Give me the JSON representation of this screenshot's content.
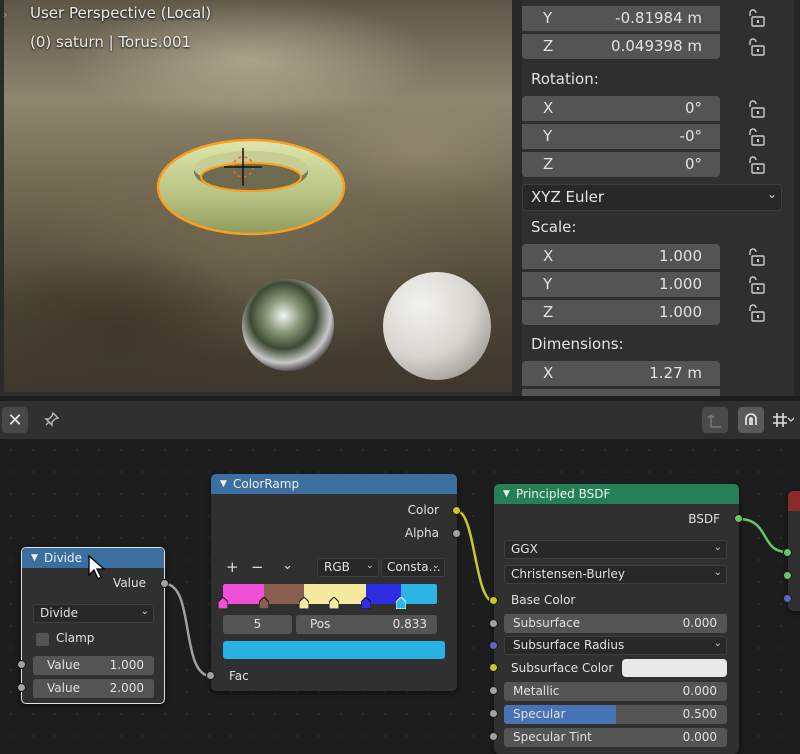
{
  "viewport": {
    "title": "User Perspective (Local)",
    "subtitle": "(0) saturn | Torus.001"
  },
  "properties": {
    "location_y": {
      "axis": "Y",
      "value": "-0.81984 m"
    },
    "location_z": {
      "axis": "Z",
      "value": "0.049398 m"
    },
    "rotation_label": "Rotation:",
    "rotation": [
      {
        "axis": "X",
        "value": "0°"
      },
      {
        "axis": "Y",
        "value": "-0°"
      },
      {
        "axis": "Z",
        "value": "0°"
      }
    ],
    "rotation_mode": "XYZ Euler",
    "scale_label": "Scale:",
    "scale": [
      {
        "axis": "X",
        "value": "1.000"
      },
      {
        "axis": "Y",
        "value": "1.000"
      },
      {
        "axis": "Z",
        "value": "1.000"
      }
    ],
    "dimensions_label": "Dimensions:",
    "dimensions": [
      {
        "axis": "X",
        "value": "1.27 m"
      }
    ]
  },
  "node_editor": {
    "divide": {
      "title": "Divide",
      "output": "Value",
      "operation": "Divide",
      "clamp_label": "Clamp",
      "inputs": [
        {
          "label": "Value",
          "value": "1.000"
        },
        {
          "label": "Value",
          "value": "2.000"
        }
      ]
    },
    "colorramp": {
      "title": "ColorRamp",
      "outputs": [
        "Color",
        "Alpha"
      ],
      "add": "+",
      "remove": "−",
      "color_mode": "RGB",
      "interpolation": "Consta…",
      "stops": [
        {
          "pos": 0.0,
          "color": "#f050d8"
        },
        {
          "pos": 0.19,
          "color": "#8a5f50"
        },
        {
          "pos": 0.38,
          "color": "#f5eaa0"
        },
        {
          "pos": 0.52,
          "color": "#f5eaa0"
        },
        {
          "pos": 0.67,
          "color": "#2e2ee0"
        },
        {
          "pos": 0.833,
          "color": "#2db4e6"
        }
      ],
      "active_index": "5",
      "pos_label": "Pos",
      "pos_value": "0.833",
      "active_color": "#27b2e3",
      "input": "Fac"
    },
    "bsdf": {
      "title": "Principled BSDF",
      "output": "BSDF",
      "distribution": "GGX",
      "subsurface_method": "Christensen-Burley",
      "base_color_label": "Base Color",
      "subsurface": {
        "label": "Subsurface",
        "value": "0.000"
      },
      "subsurface_radius": "Subsurface Radius",
      "subsurface_color": "Subsurface Color",
      "metallic": {
        "label": "Metallic",
        "value": "0.000"
      },
      "specular": {
        "label": "Specular",
        "value": "0.500",
        "fill": 0.5
      },
      "specular_tint": {
        "label": "Specular Tint",
        "value": "0.000"
      }
    }
  },
  "colors": {
    "divide_header": "#3b6fa0",
    "colorramp_header": "#3b6fa0",
    "bsdf_header": "#248055",
    "selection_outline": "#ff9e1a"
  }
}
